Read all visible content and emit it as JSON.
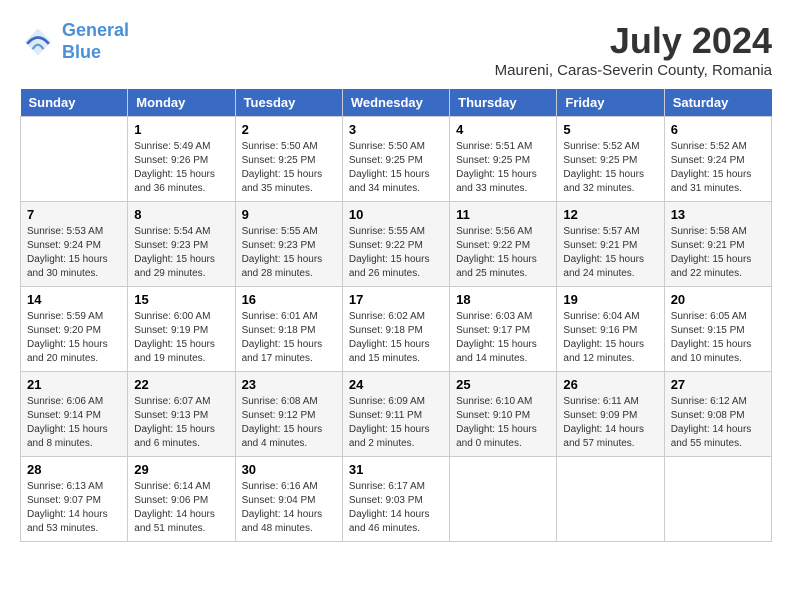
{
  "header": {
    "logo_line1": "General",
    "logo_line2": "Blue",
    "month_year": "July 2024",
    "location": "Maureni, Caras-Severin County, Romania"
  },
  "weekdays": [
    "Sunday",
    "Monday",
    "Tuesday",
    "Wednesday",
    "Thursday",
    "Friday",
    "Saturday"
  ],
  "weeks": [
    [
      {
        "day": "",
        "info": ""
      },
      {
        "day": "1",
        "info": "Sunrise: 5:49 AM\nSunset: 9:26 PM\nDaylight: 15 hours\nand 36 minutes."
      },
      {
        "day": "2",
        "info": "Sunrise: 5:50 AM\nSunset: 9:25 PM\nDaylight: 15 hours\nand 35 minutes."
      },
      {
        "day": "3",
        "info": "Sunrise: 5:50 AM\nSunset: 9:25 PM\nDaylight: 15 hours\nand 34 minutes."
      },
      {
        "day": "4",
        "info": "Sunrise: 5:51 AM\nSunset: 9:25 PM\nDaylight: 15 hours\nand 33 minutes."
      },
      {
        "day": "5",
        "info": "Sunrise: 5:52 AM\nSunset: 9:25 PM\nDaylight: 15 hours\nand 32 minutes."
      },
      {
        "day": "6",
        "info": "Sunrise: 5:52 AM\nSunset: 9:24 PM\nDaylight: 15 hours\nand 31 minutes."
      }
    ],
    [
      {
        "day": "7",
        "info": "Sunrise: 5:53 AM\nSunset: 9:24 PM\nDaylight: 15 hours\nand 30 minutes."
      },
      {
        "day": "8",
        "info": "Sunrise: 5:54 AM\nSunset: 9:23 PM\nDaylight: 15 hours\nand 29 minutes."
      },
      {
        "day": "9",
        "info": "Sunrise: 5:55 AM\nSunset: 9:23 PM\nDaylight: 15 hours\nand 28 minutes."
      },
      {
        "day": "10",
        "info": "Sunrise: 5:55 AM\nSunset: 9:22 PM\nDaylight: 15 hours\nand 26 minutes."
      },
      {
        "day": "11",
        "info": "Sunrise: 5:56 AM\nSunset: 9:22 PM\nDaylight: 15 hours\nand 25 minutes."
      },
      {
        "day": "12",
        "info": "Sunrise: 5:57 AM\nSunset: 9:21 PM\nDaylight: 15 hours\nand 24 minutes."
      },
      {
        "day": "13",
        "info": "Sunrise: 5:58 AM\nSunset: 9:21 PM\nDaylight: 15 hours\nand 22 minutes."
      }
    ],
    [
      {
        "day": "14",
        "info": "Sunrise: 5:59 AM\nSunset: 9:20 PM\nDaylight: 15 hours\nand 20 minutes."
      },
      {
        "day": "15",
        "info": "Sunrise: 6:00 AM\nSunset: 9:19 PM\nDaylight: 15 hours\nand 19 minutes."
      },
      {
        "day": "16",
        "info": "Sunrise: 6:01 AM\nSunset: 9:18 PM\nDaylight: 15 hours\nand 17 minutes."
      },
      {
        "day": "17",
        "info": "Sunrise: 6:02 AM\nSunset: 9:18 PM\nDaylight: 15 hours\nand 15 minutes."
      },
      {
        "day": "18",
        "info": "Sunrise: 6:03 AM\nSunset: 9:17 PM\nDaylight: 15 hours\nand 14 minutes."
      },
      {
        "day": "19",
        "info": "Sunrise: 6:04 AM\nSunset: 9:16 PM\nDaylight: 15 hours\nand 12 minutes."
      },
      {
        "day": "20",
        "info": "Sunrise: 6:05 AM\nSunset: 9:15 PM\nDaylight: 15 hours\nand 10 minutes."
      }
    ],
    [
      {
        "day": "21",
        "info": "Sunrise: 6:06 AM\nSunset: 9:14 PM\nDaylight: 15 hours\nand 8 minutes."
      },
      {
        "day": "22",
        "info": "Sunrise: 6:07 AM\nSunset: 9:13 PM\nDaylight: 15 hours\nand 6 minutes."
      },
      {
        "day": "23",
        "info": "Sunrise: 6:08 AM\nSunset: 9:12 PM\nDaylight: 15 hours\nand 4 minutes."
      },
      {
        "day": "24",
        "info": "Sunrise: 6:09 AM\nSunset: 9:11 PM\nDaylight: 15 hours\nand 2 minutes."
      },
      {
        "day": "25",
        "info": "Sunrise: 6:10 AM\nSunset: 9:10 PM\nDaylight: 15 hours\nand 0 minutes."
      },
      {
        "day": "26",
        "info": "Sunrise: 6:11 AM\nSunset: 9:09 PM\nDaylight: 14 hours\nand 57 minutes."
      },
      {
        "day": "27",
        "info": "Sunrise: 6:12 AM\nSunset: 9:08 PM\nDaylight: 14 hours\nand 55 minutes."
      }
    ],
    [
      {
        "day": "28",
        "info": "Sunrise: 6:13 AM\nSunset: 9:07 PM\nDaylight: 14 hours\nand 53 minutes."
      },
      {
        "day": "29",
        "info": "Sunrise: 6:14 AM\nSunset: 9:06 PM\nDaylight: 14 hours\nand 51 minutes."
      },
      {
        "day": "30",
        "info": "Sunrise: 6:16 AM\nSunset: 9:04 PM\nDaylight: 14 hours\nand 48 minutes."
      },
      {
        "day": "31",
        "info": "Sunrise: 6:17 AM\nSunset: 9:03 PM\nDaylight: 14 hours\nand 46 minutes."
      },
      {
        "day": "",
        "info": ""
      },
      {
        "day": "",
        "info": ""
      },
      {
        "day": "",
        "info": ""
      }
    ]
  ]
}
